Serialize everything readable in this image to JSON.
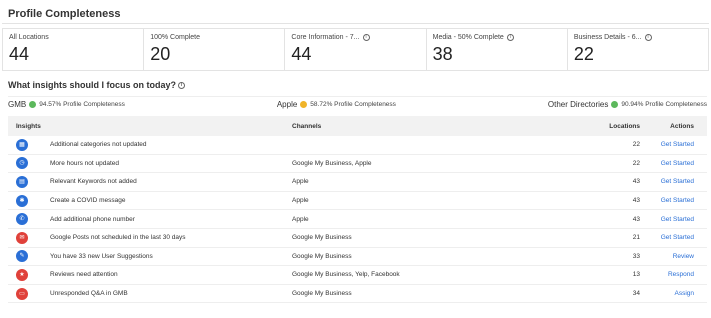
{
  "title": "Profile Completeness",
  "stats": [
    {
      "label": "All Locations",
      "value": "44",
      "info": false
    },
    {
      "label": "100% Complete",
      "value": "20",
      "info": false
    },
    {
      "label": "Core Information - 7...",
      "value": "44",
      "info": true
    },
    {
      "label": "Media - 50% Complete",
      "value": "38",
      "info": true
    },
    {
      "label": "Business Details - 6...",
      "value": "22",
      "info": true
    }
  ],
  "insights_title": "What insights should I focus on today?",
  "summary": [
    {
      "name": "GMB",
      "text": "94.57% Profile Completeness",
      "color": "#5cb85c"
    },
    {
      "name": "Apple",
      "text": "58.72% Profile Completeness",
      "color": "#f0b429"
    },
    {
      "name": "Other Directories",
      "text": "90.94% Profile Completeness",
      "color": "#5cb85c"
    }
  ],
  "table": {
    "headers": {
      "insights": "Insights",
      "channels": "Channels",
      "locations": "Locations",
      "actions": "Actions"
    },
    "rows": [
      {
        "icon": "category-icon",
        "color": "#2a6fd6",
        "glyph": "▦",
        "insight": "Additional categories not updated",
        "channels": "",
        "locations": "22",
        "action": "Get Started"
      },
      {
        "icon": "clock-icon",
        "color": "#2a6fd6",
        "glyph": "◷",
        "insight": "More hours not updated",
        "channels": "Google My Business, Apple",
        "locations": "22",
        "action": "Get Started"
      },
      {
        "icon": "keyword-icon",
        "color": "#2a6fd6",
        "glyph": "▤",
        "insight": "Relevant Keywords not added",
        "channels": "Apple",
        "locations": "43",
        "action": "Get Started"
      },
      {
        "icon": "covid-icon",
        "color": "#2a6fd6",
        "glyph": "✱",
        "insight": "Create a COVID message",
        "channels": "Apple",
        "locations": "43",
        "action": "Get Started"
      },
      {
        "icon": "phone-icon",
        "color": "#2a6fd6",
        "glyph": "✆",
        "insight": "Add additional phone number",
        "channels": "Apple",
        "locations": "43",
        "action": "Get Started"
      },
      {
        "icon": "mail-icon",
        "color": "#e0413a",
        "glyph": "✉",
        "insight": "Google Posts not scheduled in the last 30 days",
        "channels": "Google My Business",
        "locations": "21",
        "action": "Get Started"
      },
      {
        "icon": "suggestion-icon",
        "color": "#2a6fd6",
        "glyph": "✎",
        "insight": "You have 33 new User Suggestions",
        "channels": "Google My Business",
        "locations": "33",
        "action": "Review"
      },
      {
        "icon": "star-icon",
        "color": "#e0413a",
        "glyph": "★",
        "insight": "Reviews need attention",
        "channels": "Google My Business, Yelp, Facebook",
        "locations": "13",
        "action": "Respond"
      },
      {
        "icon": "chat-icon",
        "color": "#e0413a",
        "glyph": "▭",
        "insight": "Unresponded Q&A in GMB",
        "channels": "Google My Business",
        "locations": "34",
        "action": "Assign"
      }
    ]
  }
}
